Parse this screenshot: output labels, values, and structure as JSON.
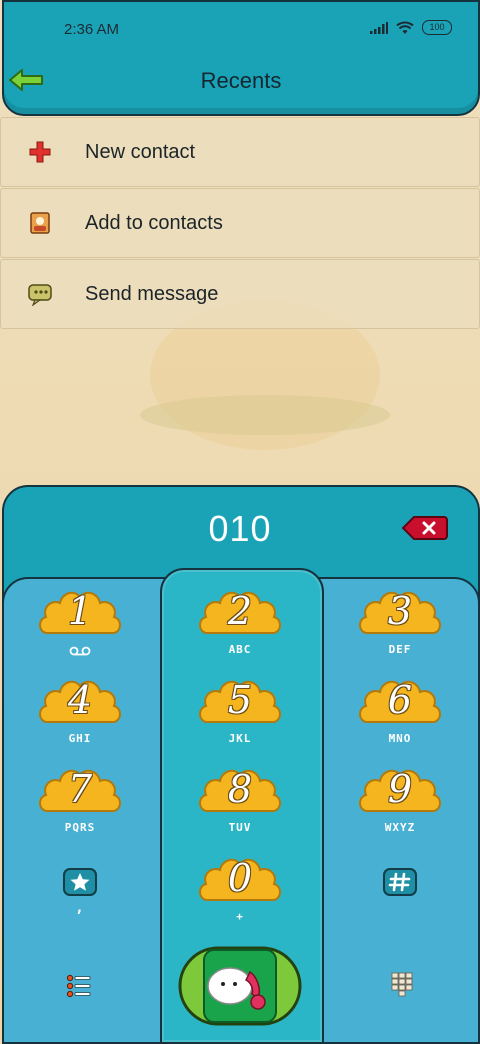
{
  "status_bar": {
    "time": "2:36 AM",
    "battery": "100"
  },
  "header": {
    "title": "Recents"
  },
  "menu": [
    {
      "label": "New contact",
      "icon": "plus-icon"
    },
    {
      "label": "Add to contacts",
      "icon": "contact-card-icon"
    },
    {
      "label": "Send message",
      "icon": "message-icon"
    }
  ],
  "dialer": {
    "number": "010",
    "keys": [
      {
        "digit": "1",
        "letters": ""
      },
      {
        "digit": "2",
        "letters": "ABC"
      },
      {
        "digit": "3",
        "letters": "DEF"
      },
      {
        "digit": "4",
        "letters": "GHI"
      },
      {
        "digit": "5",
        "letters": "JKL"
      },
      {
        "digit": "6",
        "letters": "MNO"
      },
      {
        "digit": "7",
        "letters": "PQRS"
      },
      {
        "digit": "8",
        "letters": "TUV"
      },
      {
        "digit": "9",
        "letters": "WXYZ"
      },
      {
        "digit": "0",
        "letters": "+"
      }
    ],
    "star_sub": ","
  },
  "colors": {
    "header": "#1aa3b7",
    "pad": "#47b0d3",
    "pad_center": "#2bb6c7",
    "key_cloud": "#f5b51f",
    "call_green": "#7ec93b"
  }
}
